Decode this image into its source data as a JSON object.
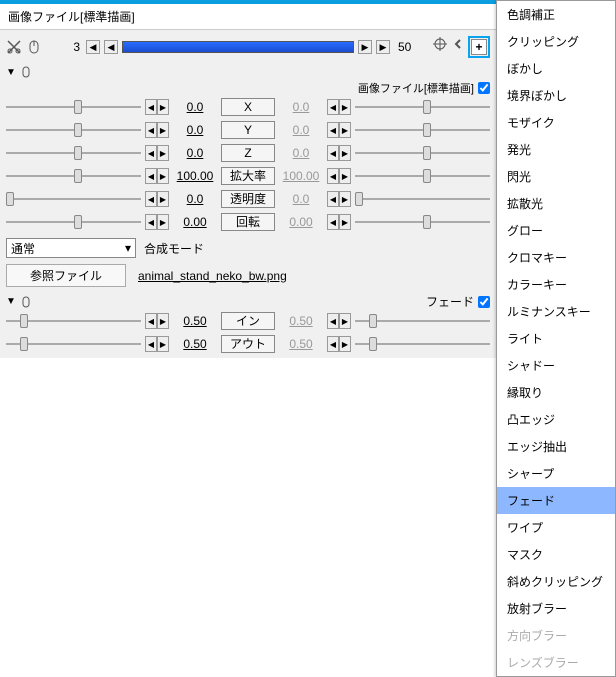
{
  "title": "画像ファイル[標準描画]",
  "timeline": {
    "cur": "3",
    "end": "50"
  },
  "sub1": {
    "label": "画像ファイル[標準描画]"
  },
  "params1": [
    {
      "l": 50,
      "vL": "0.0",
      "btn": "X",
      "vR": "0.0",
      "r": 50
    },
    {
      "l": 50,
      "vL": "0.0",
      "btn": "Y",
      "vR": "0.0",
      "r": 50
    },
    {
      "l": 50,
      "vL": "0.0",
      "btn": "Z",
      "vR": "0.0",
      "r": 50
    },
    {
      "l": 50,
      "vL": "100.00",
      "btn": "拡大率",
      "vR": "100.00",
      "r": 50
    },
    {
      "l": 0,
      "vL": "0.0",
      "btn": "透明度",
      "vR": "0.0",
      "r": 0
    },
    {
      "l": 50,
      "vL": "0.00",
      "btn": "回転",
      "vR": "0.00",
      "r": 50
    }
  ],
  "mode": {
    "sel": "通常",
    "label": "合成モード"
  },
  "file": {
    "label": "参照ファイル",
    "name": "animal_stand_neko_bw.png"
  },
  "fade": {
    "label": "フェード"
  },
  "params2": [
    {
      "l": 10,
      "vL": "0.50",
      "btn": "イン",
      "vR": "0.50",
      "r": 10
    },
    {
      "l": 10,
      "vL": "0.50",
      "btn": "アウト",
      "vR": "0.50",
      "r": 10
    }
  ],
  "menu": [
    {
      "t": "色調補正"
    },
    {
      "t": "クリッピング"
    },
    {
      "t": "ぼかし"
    },
    {
      "t": "境界ぼかし"
    },
    {
      "t": "モザイク"
    },
    {
      "t": "発光"
    },
    {
      "t": "閃光"
    },
    {
      "t": "拡散光"
    },
    {
      "t": "グロー"
    },
    {
      "t": "クロマキー"
    },
    {
      "t": "カラーキー"
    },
    {
      "t": "ルミナンスキー"
    },
    {
      "t": "ライト"
    },
    {
      "t": "シャドー"
    },
    {
      "t": "縁取り"
    },
    {
      "t": "凸エッジ"
    },
    {
      "t": "エッジ抽出"
    },
    {
      "t": "シャープ"
    },
    {
      "t": "フェード",
      "sel": true
    },
    {
      "t": "ワイプ"
    },
    {
      "t": "マスク"
    },
    {
      "t": "斜めクリッピング"
    },
    {
      "t": "放射ブラー"
    },
    {
      "t": "方向ブラー",
      "dis": true
    },
    {
      "t": "レンズブラー",
      "dis": true
    }
  ]
}
